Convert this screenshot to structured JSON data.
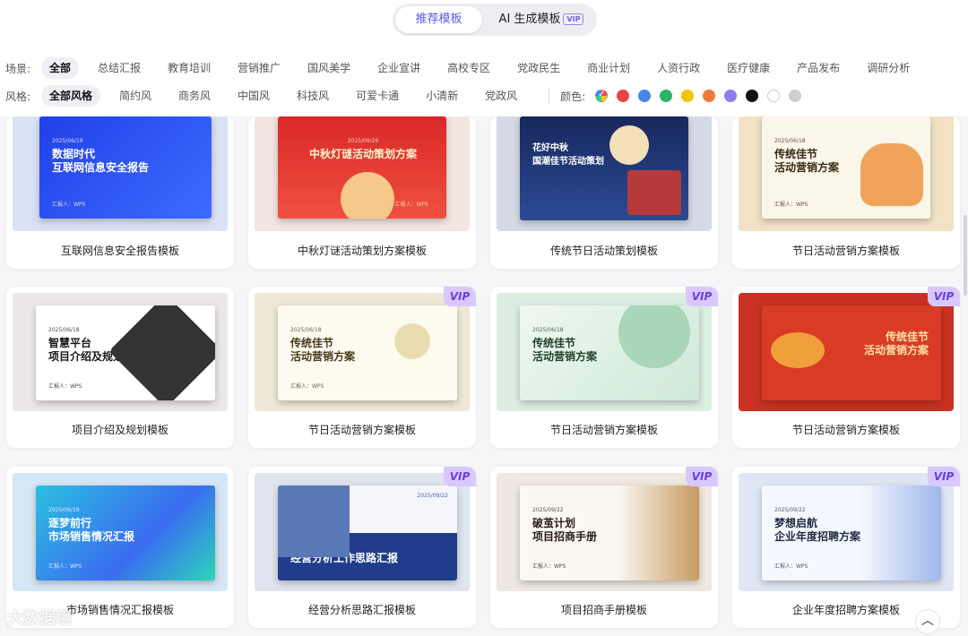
{
  "tabs": {
    "recommended": "推荐模板",
    "ai": "AI 生成模板",
    "ai_badge": "VIP"
  },
  "filters": {
    "scene_label": "场景:",
    "scenes": [
      "全部",
      "总结汇报",
      "教育培训",
      "营销推广",
      "国风美学",
      "企业宣讲",
      "高校专区",
      "党政民生",
      "商业计划",
      "人资行政",
      "医疗健康",
      "产品发布",
      "调研分析"
    ],
    "style_label": "风格:",
    "styles": [
      "全部风格",
      "简约风",
      "商务风",
      "中国风",
      "科技风",
      "可爱卡通",
      "小清新",
      "党政风"
    ],
    "color_label": "颜色:",
    "colors": [
      "all",
      "#e84545",
      "#4a86e8",
      "#2db36a",
      "#f5c400",
      "#f07a3c",
      "#8c7ef0",
      "#111111",
      "#ffffff",
      "#cfcfd3"
    ]
  },
  "cards": [
    {
      "title": "互联网信息安全报告模板",
      "vip": "",
      "slide_date": "2025/06/19",
      "slide_title": "数据时代\n互联网信息安全报告",
      "slide_foot": "汇报人：WPS"
    },
    {
      "title": "中秋灯谜活动策划方案模板",
      "vip": "",
      "slide_date": "2025/09/29",
      "slide_title": "中秋灯谜活动策划方案",
      "slide_foot": "汇报人：WPS"
    },
    {
      "title": "传统节日活动策划模板",
      "vip": "",
      "slide_date": "",
      "slide_title": "花好中秋\n国潮佳节活动策划",
      "slide_foot": ""
    },
    {
      "title": "节日活动营销方案模板",
      "vip": "",
      "slide_date": "2025/06/18",
      "slide_title": "传统佳节\n活动营销方案",
      "slide_foot": "汇报人：WPS"
    },
    {
      "title": "项目介绍及规划模板",
      "vip": "",
      "slide_date": "2025/06/18",
      "slide_title": "智慧平台\n项目介绍及规划",
      "slide_foot": "汇报人：WPS"
    },
    {
      "title": "节日活动营销方案模板",
      "vip": "VIP",
      "slide_date": "2025/06/18",
      "slide_title": "传统佳节\n活动营销方案",
      "slide_foot": "汇报人：WPS"
    },
    {
      "title": "节日活动营销方案模板",
      "vip": "VIP",
      "slide_date": "2025/06/18",
      "slide_title": "传统佳节\n活动营销方案",
      "slide_foot": ""
    },
    {
      "title": "节日活动营销方案模板",
      "vip": "VIP",
      "slide_date": "",
      "slide_title": "传统佳节\n活动营销方案",
      "slide_foot": ""
    },
    {
      "title": "市场销售情况汇报模板",
      "vip": "",
      "slide_date": "2025/06/19",
      "slide_title": "逐梦前行\n市场销售情况汇报",
      "slide_foot": "汇报人：WPS"
    },
    {
      "title": "经营分析思路汇报模板",
      "vip": "VIP",
      "slide_date": "2025/09/22",
      "slide_title": "经营分析工作思路汇报",
      "slide_foot": ""
    },
    {
      "title": "项目招商手册模板",
      "vip": "VIP",
      "slide_date": "2025/09/22",
      "slide_title": "破茧计划\n项目招商手册",
      "slide_foot": "汇报人：WPS"
    },
    {
      "title": "企业年度招聘方案模板",
      "vip": "VIP",
      "slide_date": "2025/09/22",
      "slide_title": "梦想启航\n企业年度招聘方案",
      "slide_foot": "汇报人：WPS"
    }
  ],
  "watermark": "大数据境",
  "scroll_top_icon": "chevron-up-icon"
}
